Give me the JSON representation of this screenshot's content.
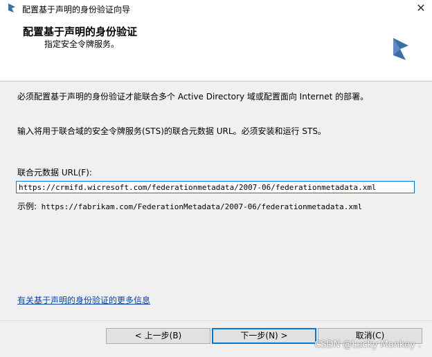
{
  "window": {
    "title": "配置基于声明的身份验证向导",
    "close_glyph": "✕"
  },
  "header": {
    "title": "配置基于声明的身份验证",
    "subtitle": "指定安全令牌服务。"
  },
  "content": {
    "intro": "必须配置基于声明的身份验证才能联合多个 Active Directory 域或配置面向 Internet 的部署。",
    "instruction": "输入将用于联合域的安全令牌服务(STS)的联合元数据 URL。必须安装和运行 STS。",
    "url_label": "联合元数据 URL(F):",
    "url_value": "https://crmifd.wicresoft.com/federationmetadata/2007-06/federationmetadata.xml",
    "example_label": "示例:",
    "example_value": "https://fabrikam.com/FederationMetadata/2007-06/federationmetadata.xml",
    "more_info_link": "有关基于声明的身份验证的更多信息"
  },
  "buttons": {
    "back": "< 上一步(B)",
    "next": "下一步(N) >",
    "cancel": "取消(C)"
  },
  "watermark": "CSDN @Lucky Monkey .",
  "colors": {
    "accent": "#0078d7",
    "logo": "#3a6ea5",
    "link": "#0645ad"
  },
  "icons": {
    "app": "dynamics-logo-icon",
    "close": "close-icon"
  }
}
